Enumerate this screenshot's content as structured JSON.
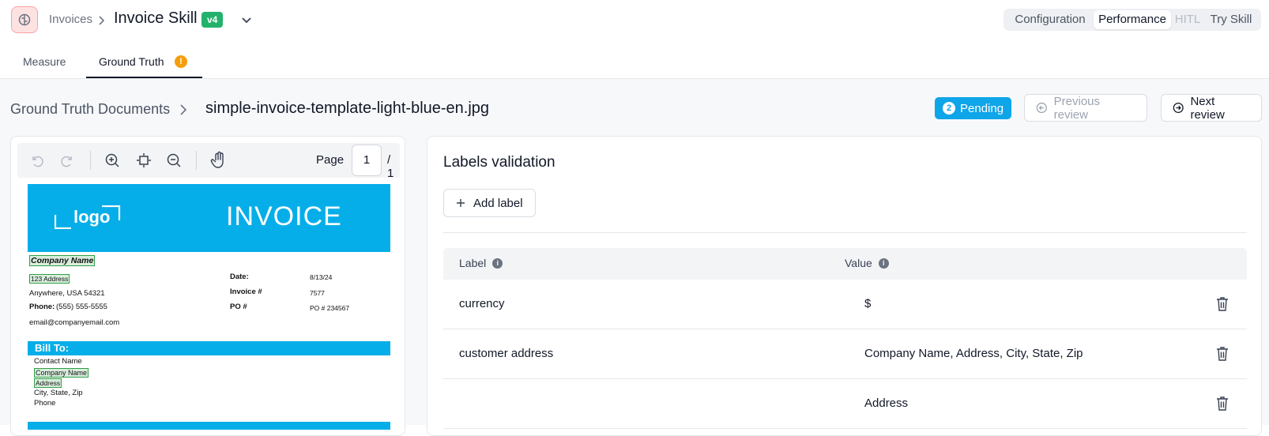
{
  "header": {
    "breadcrumb_parent": "Invoices",
    "title": "Invoice Skill",
    "version_badge": "v4",
    "nav": [
      {
        "label": "Configuration",
        "state": "normal"
      },
      {
        "label": "Performance",
        "state": "active"
      },
      {
        "label": "HITL",
        "state": "disabled"
      },
      {
        "label": "Try Skill",
        "state": "normal"
      }
    ]
  },
  "tabs": [
    {
      "label": "Measure",
      "active": false
    },
    {
      "label": "Ground Truth",
      "active": true,
      "badge": "!"
    }
  ],
  "breadcrumb": {
    "parent": "Ground Truth Documents",
    "current": "simple-invoice-template-light-blue-en.jpg"
  },
  "review": {
    "pending_count": "2",
    "pending_label": "Pending",
    "previous_label": "Previous review",
    "next_label": "Next review"
  },
  "viewer": {
    "page_label": "Page",
    "page_current": "1",
    "page_total": "/ 1"
  },
  "invoice": {
    "title": "INVOICE",
    "logo": "logo",
    "company_name": "Company Name",
    "address": "123 Address",
    "city_line": "Anywhere, USA 54321",
    "phone_label": "Phone:",
    "phone": "(555) 555-5555",
    "email": "email@companyemail.com",
    "date_label": "Date:",
    "date": "8/13/24",
    "invoice_no_label": "Invoice #",
    "invoice_no": "7577",
    "po_label": "PO #",
    "po": "PO # 234567",
    "bill_to_label": "Bill To:",
    "bill_contact": "Contact Name",
    "bill_company": "Company Name",
    "bill_address": "Address",
    "bill_city": "City, State, Zip",
    "bill_phone": "Phone"
  },
  "labels_panel": {
    "title": "Labels validation",
    "add_label": "Add label",
    "col_label": "Label",
    "col_value": "Value",
    "rows": [
      {
        "label": "currency",
        "value": "$"
      },
      {
        "label": "customer address",
        "value": "Company Name, Address, City, State, Zip"
      },
      {
        "label": "",
        "value": "Address"
      }
    ]
  },
  "colors": {
    "accent": "#06aee9",
    "pending": "#0ea5e9",
    "version_badge": "#22b26b",
    "warning": "#f59e0b"
  }
}
